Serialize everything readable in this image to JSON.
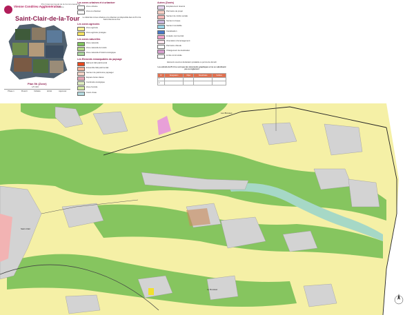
{
  "header": {
    "brand": "Vienne Condrieu Agglomération",
    "plu_title": "PLU Intercommunal de la Communauté de Vienne",
    "commune": "Saint-Clair-de-la-Tour",
    "plan": "Plan 5h (Zone)",
    "scale": "1/5 000"
  },
  "dates": {
    "headers": [
      "Phase 1",
      "Prescrit",
      "Débattu",
      "Arrêté",
      "Approuvé"
    ],
    "values": [
      "",
      "",
      "",
      "",
      ""
    ]
  },
  "legend": {
    "col1": [
      {
        "title": "Les zones urbaines et à urbaniser",
        "items": [
          {
            "color": "#ffffff",
            "label": "Zone urbaine"
          },
          {
            "color": "#ffffff",
            "label": "Zone à urbaniser"
          }
        ]
      },
      {
        "title": "",
        "note": "Le détail des zones urbaines et à urbaniser est disponible dans le PLU de Saint-Clair-de-la-Tour"
      },
      {
        "title": "Les zones agricoles",
        "items": [
          {
            "color": "#f7f09a",
            "label": "Zone agricole"
          },
          {
            "color": "#f2e260",
            "label": "Zone agricole protégée"
          }
        ]
      },
      {
        "title": "Les zones naturelles",
        "items": [
          {
            "color": "#7fc35c",
            "label": "Zone naturelle"
          },
          {
            "color": "#b6d98a",
            "label": "Zone naturelle de loisirs"
          },
          {
            "color": "#a9d69b",
            "label": "Zone naturelle d'intérêt écologique"
          }
        ]
      },
      {
        "title": "Les Elements remarquables du paysage",
        "items": [
          {
            "color": "#e8491f",
            "label": "Elément bâti patrimonial"
          },
          {
            "color": "#f5b39a",
            "label": "Ensemble bâti patrimonial"
          },
          {
            "color": "#f6d6c8",
            "label": "Secteur de patrimoine paysager"
          },
          {
            "color": "#e8a8b8",
            "label": "Espace boisé classé"
          },
          {
            "color": "#dfeec0",
            "label": "Continuité écologique"
          },
          {
            "color": "#d5e9a3",
            "label": "Zone humide"
          },
          {
            "color": "#b5dbe0",
            "label": "Cours d'eau"
          }
        ]
      }
    ],
    "col2": [
      {
        "title": "Autres (Zonés)",
        "items": [
          {
            "color": "#e8d7f0",
            "label": "Emplacement réservé"
          },
          {
            "color": "#fbd0c6",
            "label": "Périmètre de projet"
          },
          {
            "color": "#f6b8b8",
            "label": "Secteur de mixité sociale"
          },
          {
            "color": "#c9b6dd",
            "label": "Secteur à risque"
          },
          {
            "color": "#9ad3e5",
            "label": "Secteur inondable"
          },
          {
            "color": "#4a78c6",
            "label": "Canalisation"
          },
          {
            "color": "#f0a0c8",
            "label": "Linéaire commercial"
          },
          {
            "color": "#ffe3ec",
            "label": "Orientation d'aménagement"
          },
          {
            "color": "#ffffff",
            "label": "Périmètre d'étude"
          },
          {
            "color": "#d9a0d0",
            "label": "Changement de destination"
          },
          {
            "color": "#ffffff",
            "label": "Limite communale"
          }
        ]
      }
    ],
    "note2": "Elements soumis à déclaration préalable ou permis de démolir",
    "note3": "Les extraits du PLU ne sont que des documents graphiques et ne se substituent pas au règlement",
    "obs_headers": [
      "N°",
      "Désignation",
      "Objet",
      "Bénéficiaire",
      "Surface"
    ],
    "obs_rows": [
      [
        "1",
        "",
        "",
        "",
        ""
      ],
      [
        "2",
        "",
        "",
        "",
        ""
      ]
    ]
  },
  "map": {
    "labels": [
      "La Tour",
      "Saint-Clair",
      "Les Brosses",
      "Le Rousset"
    ]
  }
}
